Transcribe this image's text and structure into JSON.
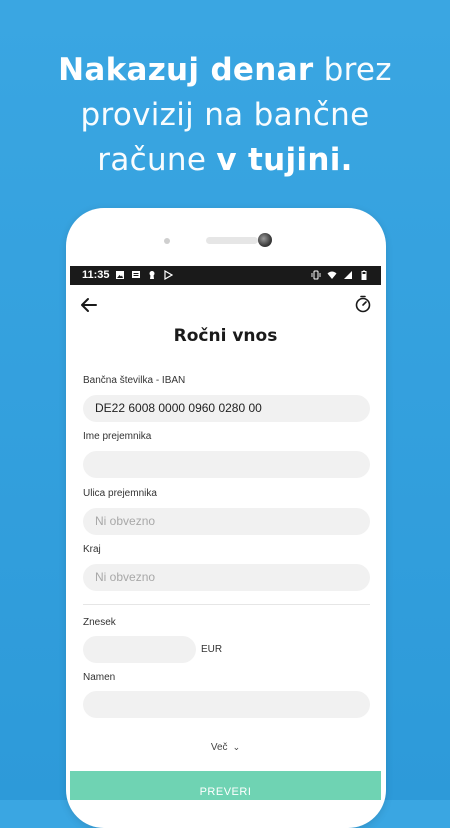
{
  "headline": {
    "line1_bold": "Nakazuj denar",
    "line1_light": " brez",
    "line2": "provizij na bančne",
    "line3_light": "račune ",
    "line3_bold": "v tujini."
  },
  "statusbar": {
    "time": "11:35"
  },
  "screen": {
    "title": "Ročni vnos",
    "fields": {
      "iban": {
        "label": "Bančna številka - IBAN",
        "value": "DE22 6008 0000 0960 0280 00"
      },
      "name": {
        "label": "Ime prejemnika",
        "value": ""
      },
      "street": {
        "label": "Ulica prejemnika",
        "placeholder": "Ni obvezno"
      },
      "city": {
        "label": "Kraj",
        "placeholder": "Ni obvezno"
      },
      "amount": {
        "label": "Znesek",
        "value": "",
        "currency": "EUR"
      },
      "purpose": {
        "label": "Namen",
        "value": ""
      }
    },
    "more_label": "Več",
    "submit_label": "PREVERI"
  },
  "colors": {
    "background": "#2d9ad9",
    "accent_button": "#6fd3b3",
    "field_bg": "#f1f1f1"
  },
  "icons": [
    "back-arrow-icon",
    "timer-icon",
    "wifi-icon",
    "battery-icon",
    "vibrate-icon",
    "chevron-down-icon"
  ]
}
